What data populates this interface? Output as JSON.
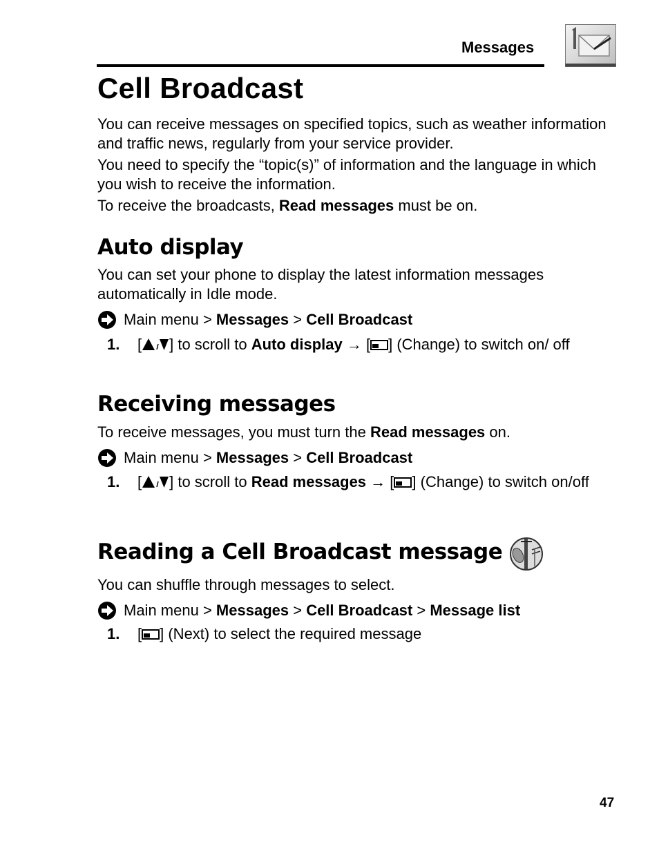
{
  "header": {
    "section_label": "Messages",
    "section_icon": "message-envelope-icon"
  },
  "title": "Cell Broadcast",
  "intro": {
    "p1": "You can receive messages on specified topics, such as weather information and traffic news, regularly from your service provider.",
    "p2": "You need to specify the “topic(s)” of information and the language in which you wish to receive the information.",
    "p3_pre": "To receive the broadcasts, ",
    "p3_bold": "Read messages",
    "p3_post": " must be on."
  },
  "sections": [
    {
      "heading": "Auto display",
      "body": "You can set your phone to display the latest information messages automatically in Idle mode.",
      "nav": {
        "prefix": "Main menu",
        "sep": " > ",
        "items": [
          "Messages",
          "Cell Broadcast"
        ]
      },
      "step": {
        "num": "1.",
        "pre": "] to scroll to ",
        "bold": "Auto display",
        "post": "] (Change) to switch on/ off"
      }
    },
    {
      "heading": "Receiving messages",
      "body_pre": "To receive messages, you must turn the ",
      "body_bold": "Read messages",
      "body_post": " on.",
      "nav": {
        "prefix": "Main menu",
        "sep": " > ",
        "items": [
          "Messages",
          "Cell Broadcast"
        ]
      },
      "step": {
        "num": "1.",
        "pre": "] to scroll to ",
        "bold": "Read messages",
        "post": "] (Change) to switch on/off"
      }
    },
    {
      "heading": "Reading a Cell Broadcast message",
      "heading_icon": "network-service-icon",
      "body": "You can shuffle through messages to select.",
      "nav": {
        "prefix": "Main menu",
        "sep": " > ",
        "items": [
          "Messages",
          "Cell Broadcast",
          "Message list"
        ]
      },
      "step": {
        "num": "1.",
        "post": "] (Next) to select the required message"
      }
    }
  ],
  "page_number": "47"
}
